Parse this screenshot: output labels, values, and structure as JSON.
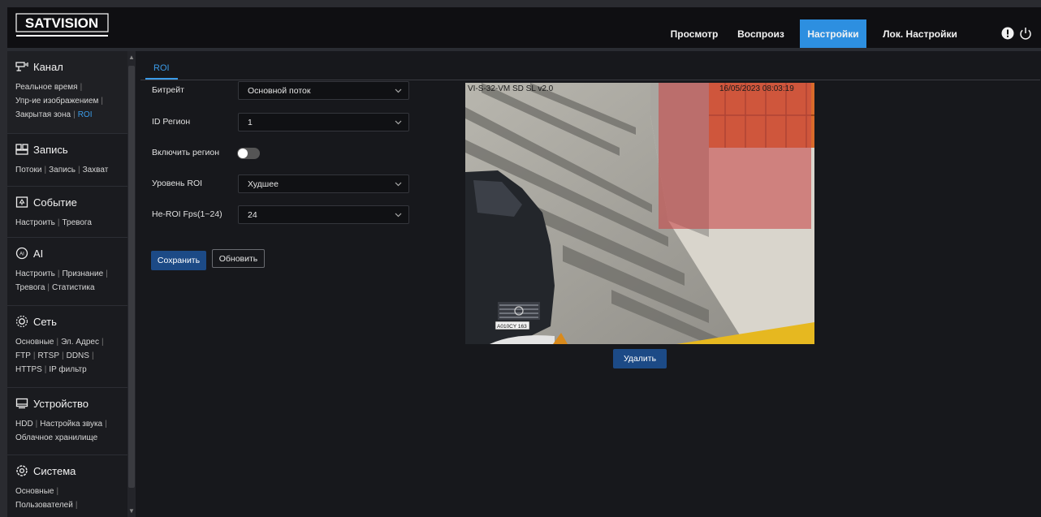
{
  "header": {
    "logo_text": "SATVISION",
    "nav": [
      {
        "label": "Просмотр",
        "active": false
      },
      {
        "label": "Воспроиз",
        "active": false
      },
      {
        "label": "Настройки",
        "active": true
      },
      {
        "label": "Лок. Настройки",
        "active": false
      }
    ],
    "icons": [
      "alert-icon",
      "power-icon"
    ]
  },
  "sidebar": {
    "sections": [
      {
        "title": "Канал",
        "icon": "channel-icon",
        "links": [
          "Реальное время",
          "Упр-ие изображением",
          "Закрытая зона",
          "ROI"
        ],
        "current": "ROI"
      },
      {
        "title": "Запись",
        "icon": "record-icon",
        "links": [
          "Потоки",
          "Запись",
          "Захват"
        ]
      },
      {
        "title": "Событие",
        "icon": "event-icon",
        "links": [
          "Настроить",
          "Тревога"
        ]
      },
      {
        "title": "AI",
        "icon": "ai-icon",
        "links": [
          "Настроить",
          "Признание",
          "Тревога",
          "Статистика"
        ]
      },
      {
        "title": "Сеть",
        "icon": "network-icon",
        "links": [
          "Основные",
          "Эл. Адрес",
          "FTP",
          "RTSP",
          "DDNS",
          "HTTPS",
          "IP фильтр"
        ]
      },
      {
        "title": "Устройство",
        "icon": "device-icon",
        "links": [
          "HDD",
          "Настройка звука",
          "Облачное хранилище"
        ]
      },
      {
        "title": "Система",
        "icon": "system-icon",
        "links": [
          "Основные",
          "Пользователей"
        ]
      }
    ]
  },
  "tabs": [
    {
      "label": "ROI",
      "active": true
    }
  ],
  "form": {
    "bitrate_label": "Битрейт",
    "bitrate_value": "Основной поток",
    "region_id_label": "ID Регион",
    "region_id_value": "1",
    "enable_label": "Включить регион",
    "enable_on": false,
    "roi_level_label": "Уровень ROI",
    "roi_level_value": "Худшее",
    "non_roi_fps_label": "Не-ROI Fps(1~24)",
    "non_roi_fps_value": "24"
  },
  "buttons": {
    "save": "Сохранить",
    "refresh": "Обновить",
    "delete": "Удалить"
  },
  "video": {
    "osd_left": "VI-S-32-VM SD SL v2.0",
    "osd_right": "16/05/2023 08:03:19",
    "plate_text": "A010CY 163",
    "roi_color": "#c84a4a"
  }
}
